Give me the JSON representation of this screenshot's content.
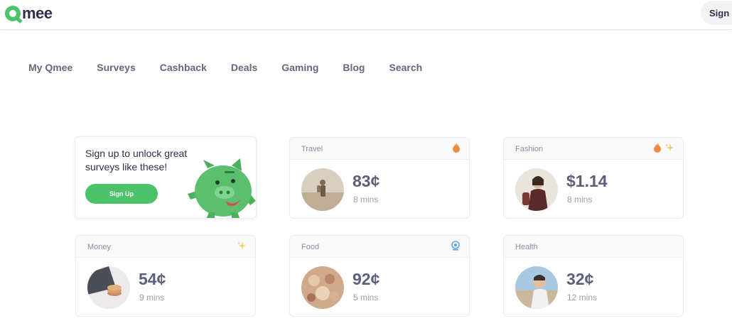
{
  "header": {
    "logo_text": "mee",
    "signup_label": "Sign up"
  },
  "nav": {
    "items": [
      "My Qmee",
      "Surveys",
      "Cashback",
      "Deals",
      "Gaming",
      "Blog",
      "Search"
    ]
  },
  "promo": {
    "text": "Sign up to unlock great surveys like these!",
    "button_label": "Sign Up"
  },
  "cards": [
    {
      "category": "Travel",
      "price": "83¢",
      "duration": "8 mins",
      "badges": [
        "fire-icon"
      ]
    },
    {
      "category": "Fashion",
      "price": "$1.14",
      "duration": "8 mins",
      "badges": [
        "fire-icon",
        "sparkle-icon"
      ]
    },
    {
      "category": "Money",
      "price": "54¢",
      "duration": "9 mins",
      "badges": [
        "sparkle-icon"
      ]
    },
    {
      "category": "Food",
      "price": "92¢",
      "duration": "5 mins",
      "badges": [
        "webcam-icon"
      ]
    },
    {
      "category": "Health",
      "price": "32¢",
      "duration": "12 mins",
      "badges": []
    }
  ],
  "colors": {
    "brand_green": "#4cc36b",
    "text_dark": "#2f2f4a",
    "text_muted": "#5b5f7a",
    "fire": "#f08a3c",
    "sparkle": "#f5c94a",
    "webcam": "#5aa9e6"
  }
}
